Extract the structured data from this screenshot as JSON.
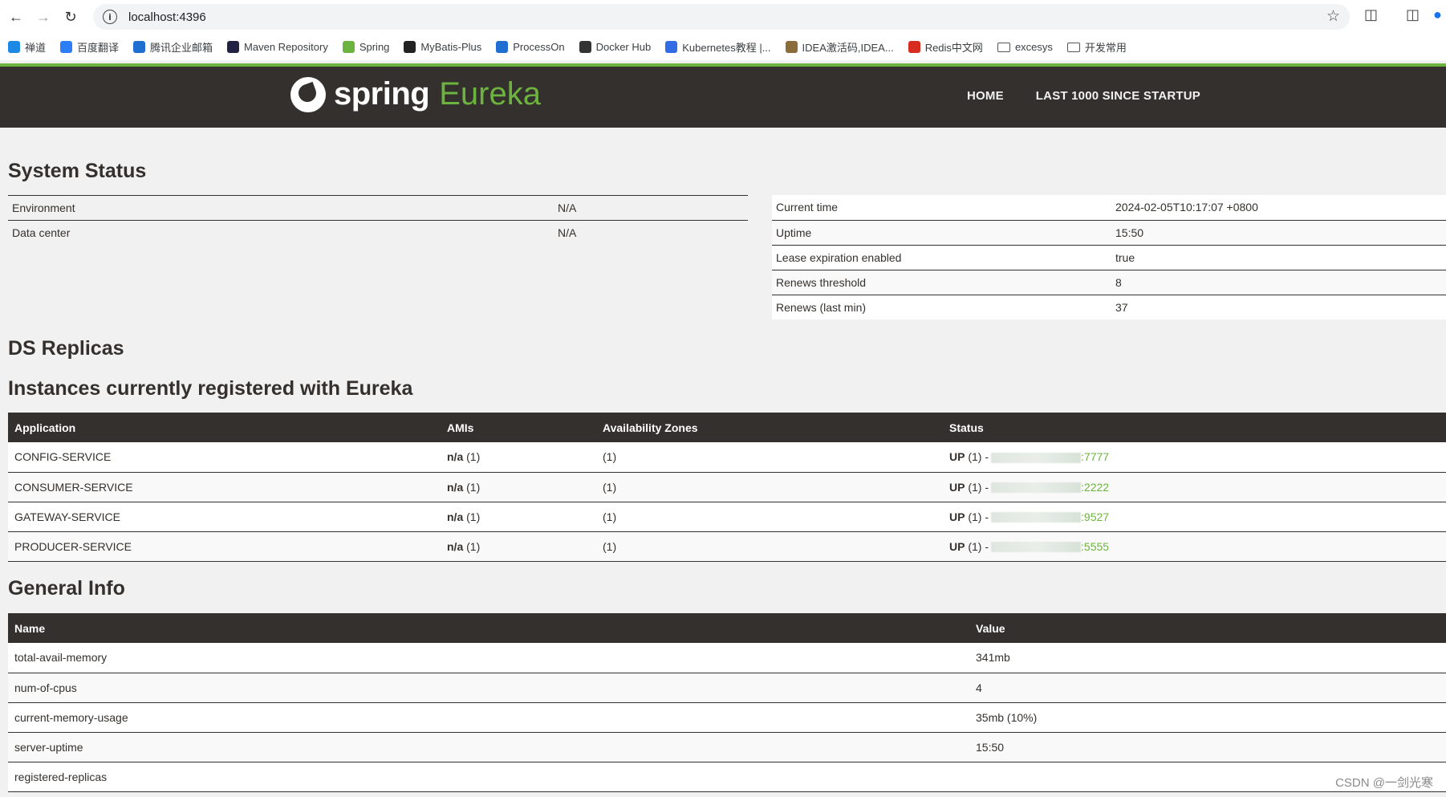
{
  "browser": {
    "url": "localhost:4396",
    "bookmarks": [
      {
        "label": "禅道",
        "icon": "zentao-icon",
        "color": "#1e88e5"
      },
      {
        "label": "百度翻译",
        "icon": "baidu-translate-icon",
        "color": "#2d7df6"
      },
      {
        "label": "腾讯企业邮箱",
        "icon": "tencent-mail-icon",
        "color": "#1f6fd1"
      },
      {
        "label": "Maven Repository",
        "icon": "maven-icon",
        "color": "#222244"
      },
      {
        "label": "Spring",
        "icon": "spring-icon",
        "color": "#6db33f"
      },
      {
        "label": "MyBatis-Plus",
        "icon": "mybatis-bird-icon",
        "color": "#222222"
      },
      {
        "label": "ProcessOn",
        "icon": "processon-icon",
        "color": "#1f6fd1"
      },
      {
        "label": "Docker Hub",
        "icon": "docker-icon",
        "color": "#333333"
      },
      {
        "label": "Kubernetes教程 |...",
        "icon": "kubernetes-icon",
        "color": "#326ce5"
      },
      {
        "label": "IDEA激活码,IDEA...",
        "icon": "idea-person-icon",
        "color": "#8a6d3b"
      },
      {
        "label": "Redis中文网",
        "icon": "redis-icon",
        "color": "#d82c20"
      },
      {
        "label": "excesys",
        "icon": "folder-icon",
        "color": "#555555"
      },
      {
        "label": "开发常用",
        "icon": "folder-icon",
        "color": "#555555"
      }
    ]
  },
  "header": {
    "logo_spring": "spring",
    "logo_eureka": "Eureka",
    "nav": [
      "HOME",
      "LAST 1000 SINCE STARTUP"
    ]
  },
  "system_status": {
    "title": "System Status",
    "left": [
      {
        "key": "Environment",
        "value": "N/A"
      },
      {
        "key": "Data center",
        "value": "N/A"
      }
    ],
    "right": [
      {
        "key": "Current time",
        "value": "2024-02-05T10:17:07 +0800"
      },
      {
        "key": "Uptime",
        "value": "15:50"
      },
      {
        "key": "Lease expiration enabled",
        "value": "true"
      },
      {
        "key": "Renews threshold",
        "value": "8"
      },
      {
        "key": "Renews (last min)",
        "value": "37"
      }
    ]
  },
  "ds_replicas": {
    "title": "DS Replicas"
  },
  "instances": {
    "title": "Instances currently registered with Eureka",
    "columns": [
      "Application",
      "AMIs",
      "Availability Zones",
      "Status"
    ],
    "rows": [
      {
        "app": "CONFIG-SERVICE",
        "ami_bold": "n/a",
        "ami_count": "(1)",
        "zones": "(1)",
        "status_bold": "UP",
        "status_count": "(1) -",
        "port": ":7777"
      },
      {
        "app": "CONSUMER-SERVICE",
        "ami_bold": "n/a",
        "ami_count": "(1)",
        "zones": "(1)",
        "status_bold": "UP",
        "status_count": "(1) -",
        "port": ":2222"
      },
      {
        "app": "GATEWAY-SERVICE",
        "ami_bold": "n/a",
        "ami_count": "(1)",
        "zones": "(1)",
        "status_bold": "UP",
        "status_count": "(1) -",
        "port": ":9527"
      },
      {
        "app": "PRODUCER-SERVICE",
        "ami_bold": "n/a",
        "ami_count": "(1)",
        "zones": "(1)",
        "status_bold": "UP",
        "status_count": "(1) -",
        "port": ":5555"
      }
    ]
  },
  "general_info": {
    "title": "General Info",
    "columns": [
      "Name",
      "Value"
    ],
    "rows": [
      {
        "name": "total-avail-memory",
        "value": "341mb"
      },
      {
        "name": "num-of-cpus",
        "value": "4"
      },
      {
        "name": "current-memory-usage",
        "value": "35mb (10%)"
      },
      {
        "name": "server-uptime",
        "value": "15:50"
      },
      {
        "name": "registered-replicas",
        "value": ""
      }
    ]
  },
  "watermark": "CSDN @一剑光寒",
  "colors": {
    "brand_green": "#6db33f",
    "header_dark": "#34302d",
    "page_bg": "#f1f1f1"
  }
}
